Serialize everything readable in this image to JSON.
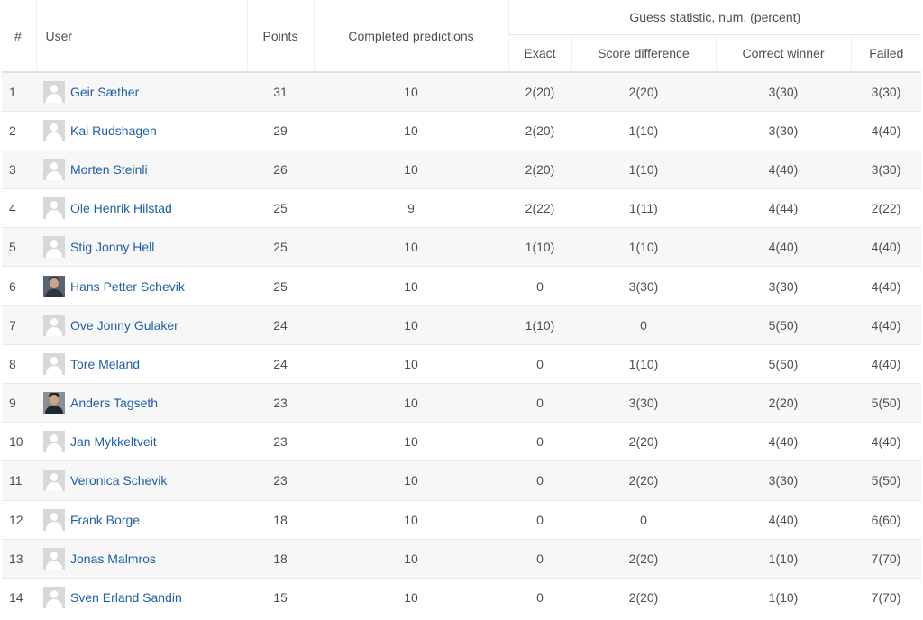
{
  "header": {
    "rank": "#",
    "user": "User",
    "points": "Points",
    "completed": "Completed predictions",
    "guess_group": "Guess statistic, num. (percent)",
    "exact": "Exact",
    "score_difference": "Score difference",
    "correct_winner": "Correct winner",
    "failed": "Failed"
  },
  "rows": [
    {
      "rank": "1",
      "name": "Geir Sæther",
      "avatar": "default-avatar-icon",
      "points": "31",
      "completed": "10",
      "exact": "2(20)",
      "score_difference": "2(20)",
      "correct_winner": "3(30)",
      "failed": "3(30)"
    },
    {
      "rank": "2",
      "name": "Kai Rudshagen",
      "avatar": "default-avatar-icon",
      "points": "29",
      "completed": "10",
      "exact": "2(20)",
      "score_difference": "1(10)",
      "correct_winner": "3(30)",
      "failed": "4(40)"
    },
    {
      "rank": "3",
      "name": "Morten Steinli",
      "avatar": "default-avatar-icon",
      "points": "26",
      "completed": "10",
      "exact": "2(20)",
      "score_difference": "1(10)",
      "correct_winner": "4(40)",
      "failed": "3(30)"
    },
    {
      "rank": "4",
      "name": "Ole Henrik Hilstad",
      "avatar": "default-avatar-icon",
      "points": "25",
      "completed": "9",
      "exact": "2(22)",
      "score_difference": "1(11)",
      "correct_winner": "4(44)",
      "failed": "2(22)"
    },
    {
      "rank": "5",
      "name": "Stig Jonny Hell",
      "avatar": "default-avatar-icon",
      "points": "25",
      "completed": "10",
      "exact": "1(10)",
      "score_difference": "1(10)",
      "correct_winner": "4(40)",
      "failed": "4(40)"
    },
    {
      "rank": "6",
      "name": "Hans Petter Schevik",
      "avatar": "photo-avatar-icon",
      "points": "25",
      "completed": "10",
      "exact": "0",
      "score_difference": "3(30)",
      "correct_winner": "3(30)",
      "failed": "4(40)"
    },
    {
      "rank": "7",
      "name": "Ove Jonny Gulaker",
      "avatar": "default-avatar-icon",
      "points": "24",
      "completed": "10",
      "exact": "1(10)",
      "score_difference": "0",
      "correct_winner": "5(50)",
      "failed": "4(40)"
    },
    {
      "rank": "8",
      "name": "Tore Meland",
      "avatar": "default-avatar-icon",
      "points": "24",
      "completed": "10",
      "exact": "0",
      "score_difference": "1(10)",
      "correct_winner": "5(50)",
      "failed": "4(40)"
    },
    {
      "rank": "9",
      "name": "Anders Tagseth",
      "avatar": "photo-avatar-icon",
      "points": "23",
      "completed": "10",
      "exact": "0",
      "score_difference": "3(30)",
      "correct_winner": "2(20)",
      "failed": "5(50)"
    },
    {
      "rank": "10",
      "name": "Jan Mykkeltveit",
      "avatar": "default-avatar-icon",
      "points": "23",
      "completed": "10",
      "exact": "0",
      "score_difference": "2(20)",
      "correct_winner": "4(40)",
      "failed": "4(40)"
    },
    {
      "rank": "11",
      "name": "Veronica Schevik",
      "avatar": "default-avatar-icon",
      "points": "23",
      "completed": "10",
      "exact": "0",
      "score_difference": "2(20)",
      "correct_winner": "3(30)",
      "failed": "5(50)"
    },
    {
      "rank": "12",
      "name": "Frank Borge",
      "avatar": "default-avatar-icon",
      "points": "18",
      "completed": "10",
      "exact": "0",
      "score_difference": "0",
      "correct_winner": "4(40)",
      "failed": "6(60)"
    },
    {
      "rank": "13",
      "name": "Jonas Malmros",
      "avatar": "default-avatar-icon",
      "points": "18",
      "completed": "10",
      "exact": "0",
      "score_difference": "2(20)",
      "correct_winner": "1(10)",
      "failed": "7(70)"
    },
    {
      "rank": "14",
      "name": "Sven Erland Sandin",
      "avatar": "default-avatar-icon",
      "points": "15",
      "completed": "10",
      "exact": "0",
      "score_difference": "2(20)",
      "correct_winner": "1(10)",
      "failed": "7(70)"
    }
  ],
  "colors": {
    "link": "#1f5fa8",
    "text": "#495057",
    "stripe": "#f7f7f7",
    "border": "#e6e8ea"
  }
}
